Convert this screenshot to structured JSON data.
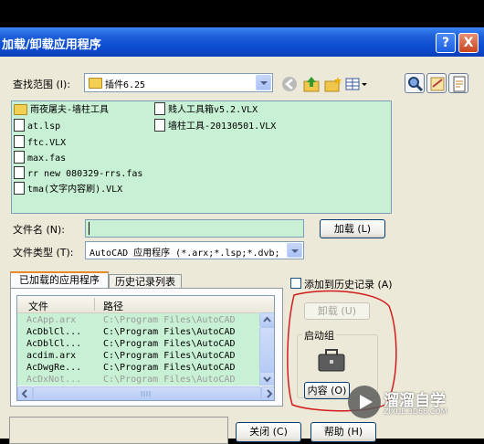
{
  "window": {
    "title": "加载/卸载应用程序",
    "help_label": "?",
    "close_label": "X"
  },
  "lookin": {
    "label": "查找范围 (I):",
    "value": "插件6.25"
  },
  "files": [
    {
      "name": "雨夜屠夫-墙柱工具",
      "type": "folder"
    },
    {
      "name": "at.lsp",
      "type": "file"
    },
    {
      "name": "ftc.VLX",
      "type": "file"
    },
    {
      "name": "max.fas",
      "type": "file"
    },
    {
      "name": "rr new 080329-rrs.fas",
      "type": "file"
    },
    {
      "name": "tma(文字内容刷).VLX",
      "type": "file"
    },
    {
      "name": "贱人工具箱v5.2.VLX",
      "type": "file"
    },
    {
      "name": "墙柱工具-20130501.VLX",
      "type": "file"
    }
  ],
  "filename": {
    "label": "文件名 (N):",
    "value": ""
  },
  "filetype": {
    "label": "文件类型 (T):",
    "value": "AutoCAD 应用程序 (*.arx;*.lsp;*.dvb;"
  },
  "load_button": "加载 (L)",
  "tabs": [
    {
      "label": "已加载的应用程序"
    },
    {
      "label": "历史记录列表"
    }
  ],
  "loaded_table": {
    "headers": [
      "文件",
      "路径"
    ],
    "rows": [
      [
        "AcApp.arx",
        "C:\\Program Files\\AutoCAD"
      ],
      [
        "AcDblCl...",
        "C:\\Program Files\\AutoCAD"
      ],
      [
        "AcDblCl...",
        "C:\\Program Files\\AutoCAD"
      ],
      [
        "acdim.arx",
        "C:\\Program Files\\AutoCAD"
      ],
      [
        "AcDwgRe...",
        "C:\\Program Files\\AutoCAD"
      ],
      [
        "AcDxNot...",
        "C:\\Program Files\\AutoCAD"
      ]
    ]
  },
  "add_history_label": "添加到历史记录 (A)",
  "unload_button": "卸载 (U)",
  "startup_suite": {
    "title": "启动组",
    "contents_button": "内容 (O)"
  },
  "close_button": "关闭 (C)",
  "help_button": "帮助 (H)",
  "watermark": {
    "brand": "溜溜自学",
    "url": "ZIXUE.3D66.COM"
  }
}
